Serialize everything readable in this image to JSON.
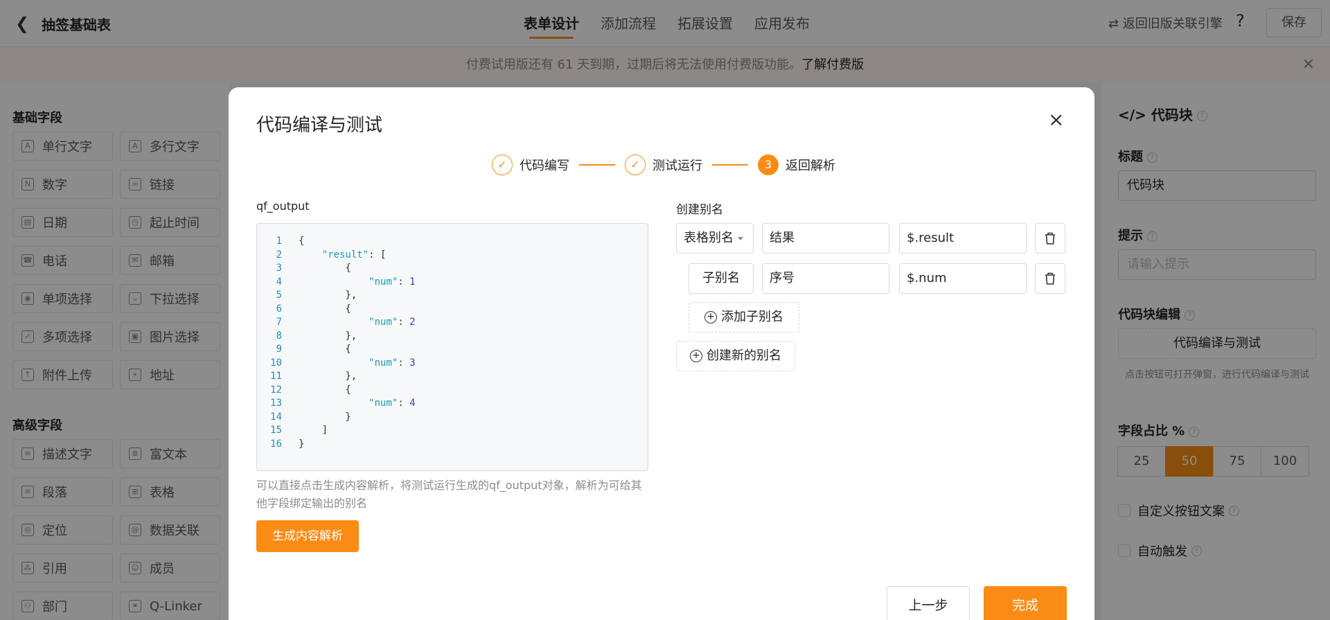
{
  "header": {
    "back_icon": "chevron-left-icon",
    "title": "抽签基础表",
    "tabs": [
      {
        "label": "表单设计",
        "active": true
      },
      {
        "label": "添加流程",
        "active": false
      },
      {
        "label": "拓展设置",
        "active": false
      },
      {
        "label": "应用发布",
        "active": false
      }
    ],
    "legacy_link": "⇄ 返回旧版关联引擎",
    "help_icon": "?",
    "save_label": "保存"
  },
  "notice": {
    "text": "付费试用版还有 61 天到期，过期后将无法使用付费版功能。",
    "link": "了解付费版",
    "close": "✕"
  },
  "left_panel": {
    "basic_title": "基础字段",
    "basic_fields": [
      "单行文字",
      "多行文字",
      "数字",
      "链接",
      "日期",
      "起止时间",
      "电话",
      "邮箱",
      "单项选择",
      "下拉选择",
      "多项选择",
      "图片选择",
      "附件上传",
      "地址"
    ],
    "advanced_title": "高级字段",
    "advanced_fields": [
      "描述文字",
      "富文本",
      "段落",
      "表格",
      "定位",
      "数据关联",
      "引用",
      "成员",
      "部门",
      "Q-Linker"
    ]
  },
  "right_panel": {
    "title": "代码块",
    "label_title": "标题",
    "title_value": "代码块",
    "label_hint": "提示",
    "hint_placeholder": "请输入提示",
    "label_editor": "代码块编辑",
    "editor_button": "代码编译与测试",
    "editor_hint": "点击按钮可打开弹窗，进行代码编译与测试",
    "label_ratio": "字段占比 %",
    "ratios": [
      "25",
      "50",
      "75",
      "100"
    ],
    "ratio_selected": "50",
    "custom_button_text": "自定义按钮文案",
    "auto_trigger": "自动触发"
  },
  "modal": {
    "title": "代码编译与测试",
    "close_icon": "×",
    "steps": [
      {
        "label": "代码编写",
        "mark": "✓"
      },
      {
        "label": "测试运行",
        "mark": "✓"
      },
      {
        "label": "返回解析",
        "mark": "3"
      }
    ],
    "output_label": "qf_output",
    "code_note": "可以直接点击生成内容解析，将测试运行生成的qf_output对象，解析为可给其他字段绑定输出的别名",
    "generate_button": "生成内容解析",
    "alias_title": "创建别名",
    "alias_row": {
      "type": "表格别名",
      "name": "结果",
      "path": "$.result"
    },
    "sub_alias_row": {
      "type": "子别名",
      "name": "序号",
      "path": "$.num"
    },
    "add_sub_alias": "添加子别名",
    "create_alias": "创建新的别名",
    "prev_button": "上一步",
    "finish_button": "完成"
  }
}
